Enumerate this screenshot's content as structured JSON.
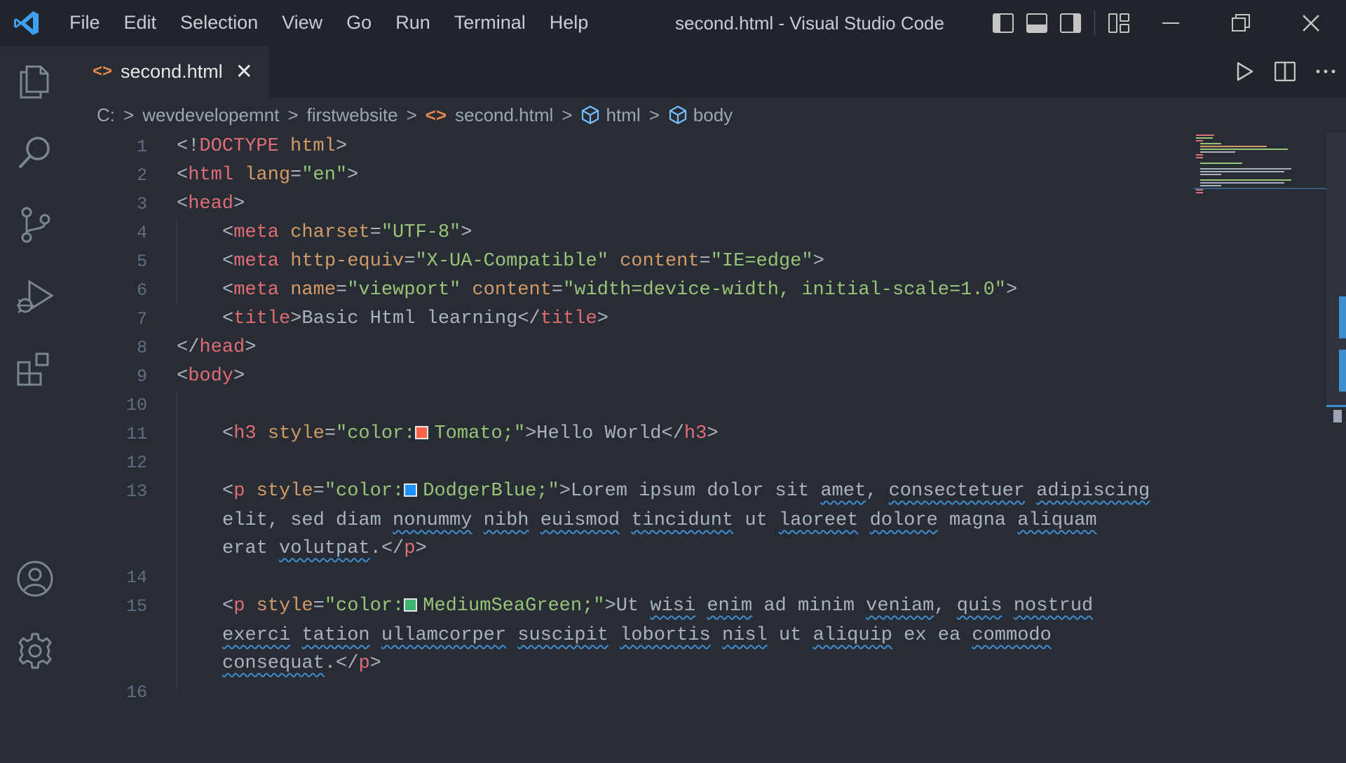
{
  "titlebar": {
    "menu": [
      "File",
      "Edit",
      "Selection",
      "View",
      "Go",
      "Run",
      "Terminal",
      "Help"
    ],
    "window_title": "second.html - Visual Studio Code"
  },
  "activitybar": {
    "items": [
      "explorer-icon",
      "search-icon",
      "source-control-icon",
      "run-debug-icon",
      "extensions-icon"
    ],
    "bottom": [
      "accounts-icon",
      "manage-gear-icon"
    ]
  },
  "tab": {
    "label": "second.html",
    "icon": "<>"
  },
  "breadcrumb": {
    "drive": "C:",
    "folder1": "wevdevelopemnt",
    "folder2": "firstwebsite",
    "file": "second.html",
    "sym1": "html",
    "sym2": "body"
  },
  "editor": {
    "line_numbers": [
      "1",
      "2",
      "3",
      "4",
      "5",
      "6",
      "7",
      "8",
      "9",
      "10",
      "11",
      "12",
      "13",
      "14",
      "15",
      "16"
    ],
    "lines": {
      "l1": {
        "p1": "<!",
        "kw": "DOCTYPE",
        "sp": " ",
        "v": "html",
        "p2": ">"
      },
      "l2": {
        "p1": "<",
        "tag": "html",
        "sp": " ",
        "attr": "lang",
        "eq": "=",
        "val": "\"en\"",
        "p2": ">"
      },
      "l3": {
        "p1": "<",
        "tag": "head",
        "p2": ">"
      },
      "l4": {
        "p1": "<",
        "tag": "meta",
        "sp": " ",
        "attr": "charset",
        "eq": "=",
        "val": "\"UTF-8\"",
        "p2": ">"
      },
      "l5": {
        "p1": "<",
        "tag": "meta",
        "sp": " ",
        "attr1": "http-equiv",
        "eq1": "=",
        "val1": "\"X-UA-Compatible\"",
        "sp2": " ",
        "attr2": "content",
        "eq2": "=",
        "val2": "\"IE=edge\"",
        "p2": ">"
      },
      "l6": {
        "p1": "<",
        "tag": "meta",
        "sp": " ",
        "attr1": "name",
        "eq1": "=",
        "val1": "\"viewport\"",
        "sp2": " ",
        "attr2": "content",
        "eq2": "=",
        "val2": "\"width=device-width, initial-scale=1.0\"",
        "p2": ">"
      },
      "l7": {
        "p1": "<",
        "tag": "title",
        "p2": ">",
        "text": "Basic Html learning",
        "p3": "</",
        "tag2": "title",
        "p4": ">"
      },
      "l8": {
        "p1": "</",
        "tag": "head",
        "p2": ">"
      },
      "l9": {
        "p1": "<",
        "tag": "body",
        "p2": ">"
      },
      "l11": {
        "p1": "<",
        "tag": "h3",
        "sp": " ",
        "attr": "style",
        "eq": "=",
        "val_a": "\"color:",
        "color_name": "Tomato;\"",
        "p2": ">",
        "text": "Hello World",
        "p3": "</",
        "tag2": "h3",
        "p4": ">"
      },
      "l13": {
        "p1": "<",
        "tag": "p",
        "sp": " ",
        "attr": "style",
        "eq": "=",
        "val_a": "\"color:",
        "color_name": "DodgerBlue;\"",
        "p2": ">"
      },
      "l15": {
        "p1": "<",
        "tag": "p",
        "sp": " ",
        "attr": "style",
        "eq": "=",
        "val_a": "\"color:",
        "color_name": "MediumSeaGreen;\"",
        "p2": ">"
      },
      "close_p": {
        "p1": "</",
        "tag": "p",
        "p2": ">"
      }
    },
    "lorem1": {
      "w1": "Lorem ipsum dolor sit ",
      "w2": "amet",
      "w3": ", ",
      "w4": "consectetuer",
      "w5": " ",
      "w6": "adipiscing",
      "w7": "elit",
      "w8": ", sed diam ",
      "w9": "nonummy",
      "w10": " ",
      "w11": "nibh",
      "w12": " ",
      "w13": "euismod",
      "w14": " ",
      "w15": "tincidunt",
      "w16": " ut ",
      "w17": "laoreet",
      "w18": " ",
      "w19": "dolore",
      "w20": " magna ",
      "w21": "aliquam",
      "w22": "erat ",
      "w23": "volutpat",
      "w24": "."
    },
    "lorem2": {
      "w1": "Ut ",
      "w2": "wisi",
      "w3": " ",
      "w4": "enim",
      "w5": " ad minim ",
      "w6": "veniam",
      "w7": ", ",
      "w8": "quis",
      "w9": " ",
      "w10": "nostrud",
      "w11": "exerci",
      "w12": " ",
      "w13": "tation",
      "w14": " ",
      "w15": "ullamcorper",
      "w16": " ",
      "w17": "suscipit",
      "w18": " ",
      "w19": "lobortis",
      "w20": " ",
      "w21": "nisl",
      "w22": " ut ",
      "w23": "aliquip",
      "w24": " ex ea ",
      "w25": "commodo",
      "w26": "consequat",
      "w27": "."
    }
  },
  "colors": {
    "tomato": "#ff6347",
    "dodgerblue": "#1e90ff",
    "mediumseagreen": "#3cb371",
    "accent": "#3e8ed0"
  }
}
